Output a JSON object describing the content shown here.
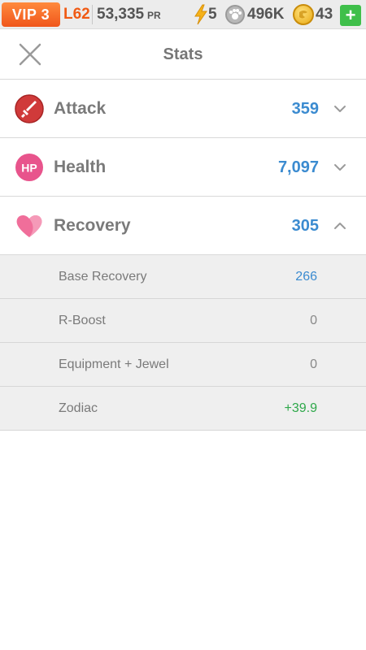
{
  "topbar": {
    "vip": "VIP 3",
    "level": "L62",
    "power": "53,335",
    "power_unit": "PR",
    "energy": "5",
    "paw_currency": "496K",
    "gold_currency": "43",
    "add_label": "+"
  },
  "header": {
    "title": "Stats"
  },
  "stats": [
    {
      "label": "Attack",
      "value": "359",
      "icon": "sword-icon",
      "expanded": false
    },
    {
      "label": "Health",
      "value": "7,097",
      "icon": "hp-icon",
      "icon_text": "HP",
      "expanded": false
    },
    {
      "label": "Recovery",
      "value": "305",
      "icon": "heart-icon",
      "expanded": true
    }
  ],
  "recovery_breakdown": [
    {
      "label": "Base Recovery",
      "value": "266",
      "color": "#3b8bd0"
    },
    {
      "label": "R-Boost",
      "value": "0",
      "color": "#888888"
    },
    {
      "label": "Equipment + Jewel",
      "value": "0",
      "color": "#888888"
    },
    {
      "label": "Zodiac",
      "value": "+39.9",
      "color": "#2ea84a"
    }
  ],
  "colors": {
    "vip_orange": "#f0561b",
    "value_blue": "#3b8bd0",
    "zodiac_green": "#2ea84a",
    "add_green": "#3fbf4a"
  }
}
